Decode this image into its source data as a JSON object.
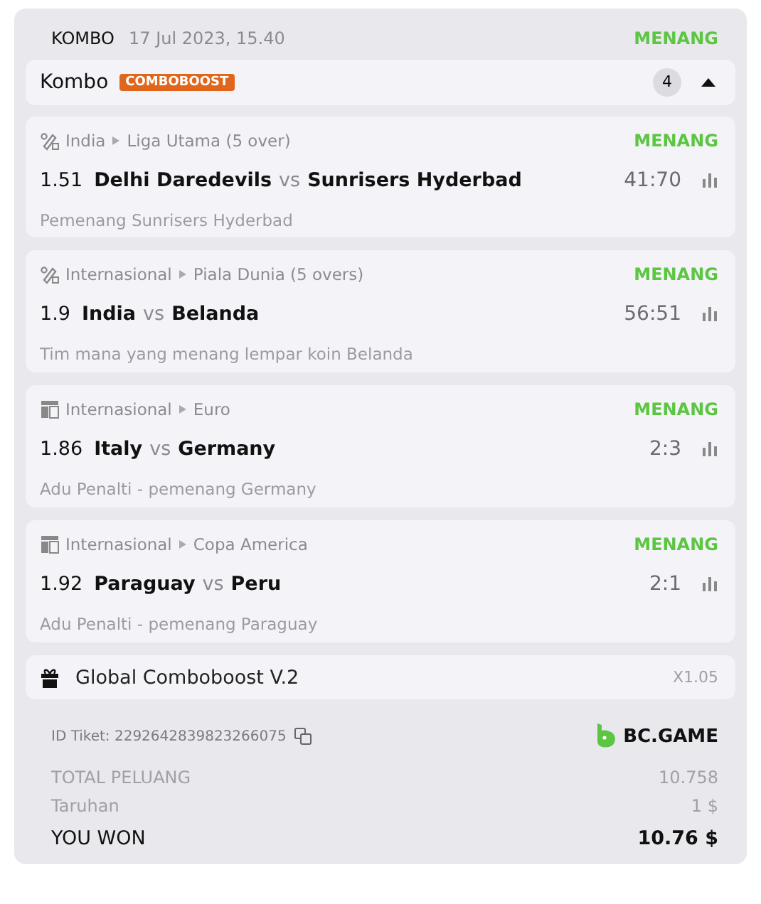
{
  "header": {
    "type": "KOMBO",
    "date": "17 Jul 2023, 15.40",
    "result": "MENANG"
  },
  "kombo": {
    "title": "Kombo",
    "badge": "COMBOBOOST",
    "count": "4",
    "expanded": true
  },
  "matches": [
    {
      "kind": "cricket",
      "country": "India",
      "league": "Liga Utama (5 over)",
      "result": "MENANG",
      "odds": "1.51",
      "home": "Delhi Daredevils",
      "vs": "vs",
      "away": "Sunrisers Hyderbad",
      "score": "41:70",
      "pick": "Pemenang Sunrisers Hyderbad"
    },
    {
      "kind": "cricket",
      "country": "Internasional",
      "league": "Piala Dunia (5 overs)",
      "result": "MENANG",
      "odds": "1.9",
      "home": "India",
      "vs": "vs",
      "away": "Belanda",
      "score": "56:51",
      "pick": "Tim mana yang menang lempar koin Belanda"
    },
    {
      "kind": "esoccer",
      "country": "Internasional",
      "league": "Euro",
      "result": "MENANG",
      "odds": "1.86",
      "home": "Italy",
      "vs": "vs",
      "away": "Germany",
      "score": "2:3",
      "pick": "Adu Penalti - pemenang Germany"
    },
    {
      "kind": "esoccer",
      "country": "Internasional",
      "league": "Copa America",
      "result": "MENANG",
      "odds": "1.92",
      "home": "Paraguay",
      "vs": "vs",
      "away": "Peru",
      "score": "2:1",
      "pick": "Adu Penalti - pemenang Paraguay"
    }
  ],
  "boost": {
    "label": "Global Comboboost V.2",
    "value": "X1.05"
  },
  "ticket": {
    "id": "ID Tiket: 2292642839823266075",
    "brand": "BC.GAME"
  },
  "totals": [
    {
      "kind": "muted",
      "label": "TOTAL PELUANG",
      "value": "10.758"
    },
    {
      "kind": "muted",
      "label": "Taruhan",
      "value": "1 $"
    },
    {
      "kind": "strong",
      "label": "YOU WON",
      "value": "10.76 $"
    }
  ]
}
